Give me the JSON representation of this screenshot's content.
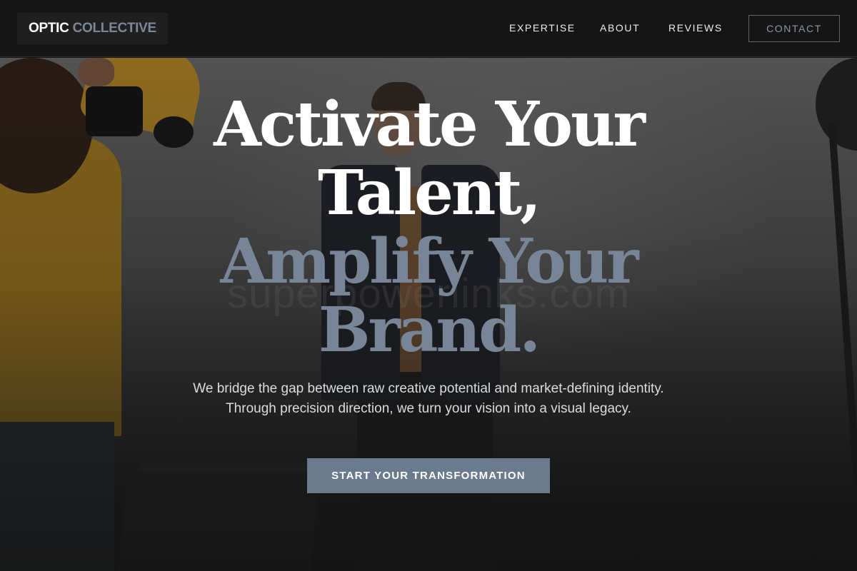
{
  "brand": {
    "part1": "OPTIC",
    "part2": "COLLECTIVE"
  },
  "nav": {
    "items": [
      {
        "label": "EXPERTISE"
      },
      {
        "label": "ABOUT"
      },
      {
        "label": "REVIEWS"
      }
    ],
    "contact_label": "CONTACT"
  },
  "hero": {
    "headline_line1": "Activate Your",
    "headline_line2": "Talent,",
    "headline_line3": "Amplify Your",
    "headline_line4": "Brand.",
    "watermark": "superpowerlinks.com",
    "subtext": "We bridge the gap between raw creative potential and market-defining identity. Through precision direction, we turn your vision into a visual legacy.",
    "cta_label": "START YOUR TRANSFORMATION"
  },
  "colors": {
    "background": "#141414",
    "header": "#151515",
    "accent_slate": "#778597",
    "cta_bg": "#6b7a8c",
    "text_white": "#ffffff"
  }
}
